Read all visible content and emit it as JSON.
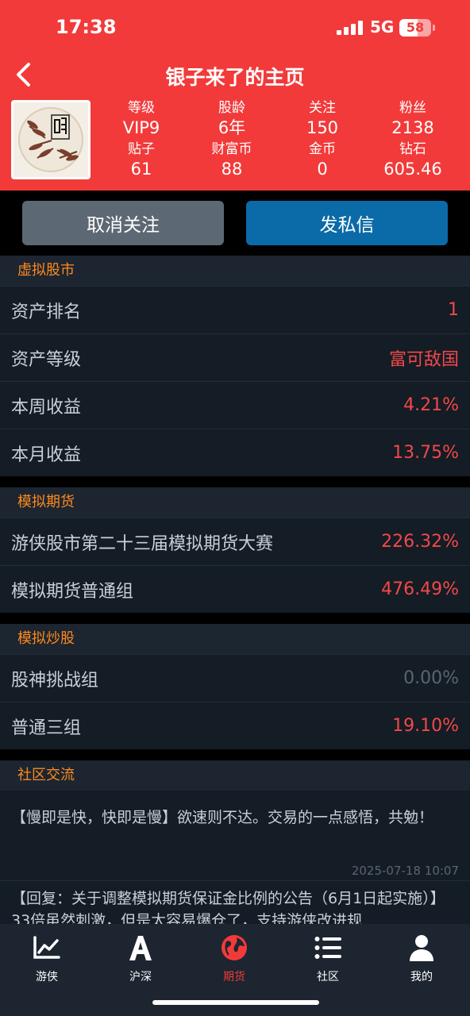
{
  "status": {
    "time": "17:38",
    "network": "5G",
    "battery": "58"
  },
  "header": {
    "title": "银子来了的主页"
  },
  "stats": [
    {
      "label": "等级",
      "value": "VIP9"
    },
    {
      "label": "股龄",
      "value": "6年"
    },
    {
      "label": "关注",
      "value": "150"
    },
    {
      "label": "粉丝",
      "value": "2138"
    },
    {
      "label": "贴子",
      "value": "61"
    },
    {
      "label": "财富币",
      "value": "88"
    },
    {
      "label": "金币",
      "value": "0"
    },
    {
      "label": "钻石",
      "value": "605.46"
    }
  ],
  "actions": {
    "unfollow": "取消关注",
    "message": "发私信"
  },
  "sections": {
    "virtual_stock": {
      "title": "虚拟股市",
      "rows": [
        {
          "label": "资产排名",
          "value": "1"
        },
        {
          "label": "资产等级",
          "value": "富可敌国"
        },
        {
          "label": "本周收益",
          "value": "4.21%"
        },
        {
          "label": "本月收益",
          "value": "13.75%"
        }
      ]
    },
    "futures": {
      "title": "模拟期货",
      "rows": [
        {
          "label": "游侠股市第二十三届模拟期货大赛",
          "value": "226.32%"
        },
        {
          "label": "模拟期货普通组",
          "value": "476.49%"
        }
      ]
    },
    "stock_sim": {
      "title": "模拟炒股",
      "rows": [
        {
          "label": "股神挑战组",
          "value": "0.00%"
        },
        {
          "label": "普通三组",
          "value": "19.10%"
        }
      ]
    },
    "community": {
      "title": "社区交流",
      "posts": [
        {
          "text": "【慢即是快，快即是慢】欲速则不达。交易的一点感悟，共勉！",
          "date": "2025-07-18 10:07"
        },
        {
          "text": "【回复：关于调整模拟期货保证金比例的公告（6月1日起实施）】33倍虽然刺激，但是太容易爆仓了，支持游侠改进规",
          "date": ""
        }
      ]
    }
  },
  "tabbar": [
    {
      "label": "游侠",
      "icon": "chart-icon"
    },
    {
      "label": "沪深",
      "icon": "letter-a-icon"
    },
    {
      "label": "期货",
      "icon": "globe-icon",
      "active": true
    },
    {
      "label": "社区",
      "icon": "list-icon"
    },
    {
      "label": "我的",
      "icon": "person-icon"
    }
  ],
  "colors": {
    "brand": "#f23a3a",
    "accent_orange": "#ff8a1c",
    "value_red": "#f24848",
    "message_blue": "#0b6aa8"
  }
}
